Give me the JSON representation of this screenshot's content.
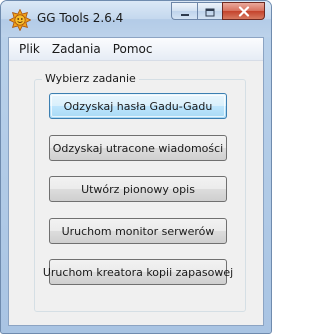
{
  "window": {
    "title": "GG Tools 2.6.4"
  },
  "menu": {
    "items": [
      "Plik",
      "Zadania",
      "Pomoc"
    ]
  },
  "group": {
    "legend": "Wybierz zadanie"
  },
  "tasks": [
    "Odzyskaj hasła Gadu-Gadu",
    "Odzyskaj utracone wiadomości",
    "Utwórz pionowy opis",
    "Uruchom monitor serwerów",
    "Uruchom kreatora kopii zapasowej"
  ],
  "icons": {
    "app": "gadu-gadu-sun-icon",
    "minimize": "minimize-icon",
    "maximize": "maximize-icon",
    "close": "close-icon"
  },
  "colors": {
    "app_icon": "#f1a21b",
    "close_button": "#c4432c",
    "default_button_border": "#3c7fb1"
  }
}
